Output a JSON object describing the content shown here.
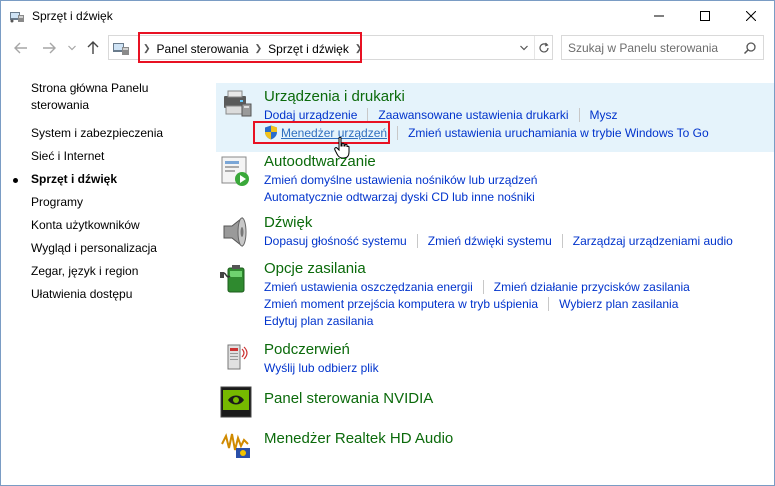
{
  "window": {
    "title": "Sprzęt i dźwięk"
  },
  "nav": {
    "breadcrumbs": [
      "Panel sterowania",
      "Sprzęt i dźwięk"
    ],
    "search_placeholder": "Szukaj w Panelu sterowania"
  },
  "sidebar": {
    "items": [
      {
        "label": "Strona główna Panelu sterowania",
        "current": false
      },
      {
        "label": "System i zabezpieczenia",
        "current": false
      },
      {
        "label": "Sieć i Internet",
        "current": false
      },
      {
        "label": "Sprzęt i dźwięk",
        "current": true
      },
      {
        "label": "Programy",
        "current": false
      },
      {
        "label": "Konta użytkowników",
        "current": false
      },
      {
        "label": "Wygląd i personalizacja",
        "current": false
      },
      {
        "label": "Zegar, język i region",
        "current": false
      },
      {
        "label": "Ułatwienia dostępu",
        "current": false
      }
    ]
  },
  "categories": {
    "devices": {
      "title": "Urządzenia i drukarki",
      "links1": [
        "Dodaj urządzenie",
        "Zaawansowane ustawienia drukarki",
        "Mysz"
      ],
      "links2": [
        "Menedżer urządzeń",
        "Zmień ustawienia uruchamiania w trybie Windows To Go"
      ]
    },
    "autoplay": {
      "title": "Autoodtwarzanie",
      "links1": [
        "Zmień domyślne ustawienia nośników lub urządzeń"
      ],
      "links2": [
        "Automatycznie odtwarzaj dyski CD lub inne nośniki"
      ]
    },
    "sound": {
      "title": "Dźwięk",
      "links1": [
        "Dopasuj głośność systemu",
        "Zmień dźwięki systemu",
        "Zarządzaj urządzeniami audio"
      ]
    },
    "power": {
      "title": "Opcje zasilania",
      "links1": [
        "Zmień ustawienia oszczędzania energii",
        "Zmień działanie przycisków zasilania"
      ],
      "links2": [
        "Zmień moment przejścia komputera w tryb uśpienia",
        "Wybierz plan zasilania"
      ],
      "links3": [
        "Edytuj plan zasilania"
      ]
    },
    "infrared": {
      "title": "Podczerwień",
      "links1": [
        "Wyślij lub odbierz plik"
      ]
    },
    "nvidia": {
      "title": "Panel sterowania NVIDIA"
    },
    "realtek": {
      "title": "Menedżer Realtek HD Audio"
    }
  },
  "colors": {
    "category_title": "#0b6a0b",
    "link": "#0033cc",
    "hover_bg": "#e5f3fb",
    "highlight": "#e81123"
  }
}
